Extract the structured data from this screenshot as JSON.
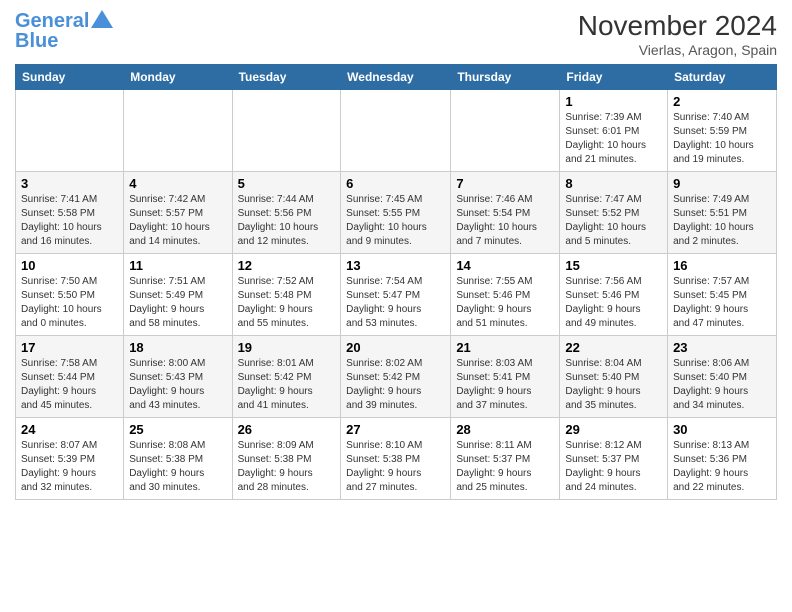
{
  "header": {
    "logo_line1": "General",
    "logo_line2": "Blue",
    "month_title": "November 2024",
    "location": "Vierlas, Aragon, Spain"
  },
  "weekdays": [
    "Sunday",
    "Monday",
    "Tuesday",
    "Wednesday",
    "Thursday",
    "Friday",
    "Saturday"
  ],
  "weeks": [
    [
      {
        "day": "",
        "info": ""
      },
      {
        "day": "",
        "info": ""
      },
      {
        "day": "",
        "info": ""
      },
      {
        "day": "",
        "info": ""
      },
      {
        "day": "",
        "info": ""
      },
      {
        "day": "1",
        "info": "Sunrise: 7:39 AM\nSunset: 6:01 PM\nDaylight: 10 hours\nand 21 minutes."
      },
      {
        "day": "2",
        "info": "Sunrise: 7:40 AM\nSunset: 5:59 PM\nDaylight: 10 hours\nand 19 minutes."
      }
    ],
    [
      {
        "day": "3",
        "info": "Sunrise: 7:41 AM\nSunset: 5:58 PM\nDaylight: 10 hours\nand 16 minutes."
      },
      {
        "day": "4",
        "info": "Sunrise: 7:42 AM\nSunset: 5:57 PM\nDaylight: 10 hours\nand 14 minutes."
      },
      {
        "day": "5",
        "info": "Sunrise: 7:44 AM\nSunset: 5:56 PM\nDaylight: 10 hours\nand 12 minutes."
      },
      {
        "day": "6",
        "info": "Sunrise: 7:45 AM\nSunset: 5:55 PM\nDaylight: 10 hours\nand 9 minutes."
      },
      {
        "day": "7",
        "info": "Sunrise: 7:46 AM\nSunset: 5:54 PM\nDaylight: 10 hours\nand 7 minutes."
      },
      {
        "day": "8",
        "info": "Sunrise: 7:47 AM\nSunset: 5:52 PM\nDaylight: 10 hours\nand 5 minutes."
      },
      {
        "day": "9",
        "info": "Sunrise: 7:49 AM\nSunset: 5:51 PM\nDaylight: 10 hours\nand 2 minutes."
      }
    ],
    [
      {
        "day": "10",
        "info": "Sunrise: 7:50 AM\nSunset: 5:50 PM\nDaylight: 10 hours\nand 0 minutes."
      },
      {
        "day": "11",
        "info": "Sunrise: 7:51 AM\nSunset: 5:49 PM\nDaylight: 9 hours\nand 58 minutes."
      },
      {
        "day": "12",
        "info": "Sunrise: 7:52 AM\nSunset: 5:48 PM\nDaylight: 9 hours\nand 55 minutes."
      },
      {
        "day": "13",
        "info": "Sunrise: 7:54 AM\nSunset: 5:47 PM\nDaylight: 9 hours\nand 53 minutes."
      },
      {
        "day": "14",
        "info": "Sunrise: 7:55 AM\nSunset: 5:46 PM\nDaylight: 9 hours\nand 51 minutes."
      },
      {
        "day": "15",
        "info": "Sunrise: 7:56 AM\nSunset: 5:46 PM\nDaylight: 9 hours\nand 49 minutes."
      },
      {
        "day": "16",
        "info": "Sunrise: 7:57 AM\nSunset: 5:45 PM\nDaylight: 9 hours\nand 47 minutes."
      }
    ],
    [
      {
        "day": "17",
        "info": "Sunrise: 7:58 AM\nSunset: 5:44 PM\nDaylight: 9 hours\nand 45 minutes."
      },
      {
        "day": "18",
        "info": "Sunrise: 8:00 AM\nSunset: 5:43 PM\nDaylight: 9 hours\nand 43 minutes."
      },
      {
        "day": "19",
        "info": "Sunrise: 8:01 AM\nSunset: 5:42 PM\nDaylight: 9 hours\nand 41 minutes."
      },
      {
        "day": "20",
        "info": "Sunrise: 8:02 AM\nSunset: 5:42 PM\nDaylight: 9 hours\nand 39 minutes."
      },
      {
        "day": "21",
        "info": "Sunrise: 8:03 AM\nSunset: 5:41 PM\nDaylight: 9 hours\nand 37 minutes."
      },
      {
        "day": "22",
        "info": "Sunrise: 8:04 AM\nSunset: 5:40 PM\nDaylight: 9 hours\nand 35 minutes."
      },
      {
        "day": "23",
        "info": "Sunrise: 8:06 AM\nSunset: 5:40 PM\nDaylight: 9 hours\nand 34 minutes."
      }
    ],
    [
      {
        "day": "24",
        "info": "Sunrise: 8:07 AM\nSunset: 5:39 PM\nDaylight: 9 hours\nand 32 minutes."
      },
      {
        "day": "25",
        "info": "Sunrise: 8:08 AM\nSunset: 5:38 PM\nDaylight: 9 hours\nand 30 minutes."
      },
      {
        "day": "26",
        "info": "Sunrise: 8:09 AM\nSunset: 5:38 PM\nDaylight: 9 hours\nand 28 minutes."
      },
      {
        "day": "27",
        "info": "Sunrise: 8:10 AM\nSunset: 5:38 PM\nDaylight: 9 hours\nand 27 minutes."
      },
      {
        "day": "28",
        "info": "Sunrise: 8:11 AM\nSunset: 5:37 PM\nDaylight: 9 hours\nand 25 minutes."
      },
      {
        "day": "29",
        "info": "Sunrise: 8:12 AM\nSunset: 5:37 PM\nDaylight: 9 hours\nand 24 minutes."
      },
      {
        "day": "30",
        "info": "Sunrise: 8:13 AM\nSunset: 5:36 PM\nDaylight: 9 hours\nand 22 minutes."
      }
    ]
  ]
}
